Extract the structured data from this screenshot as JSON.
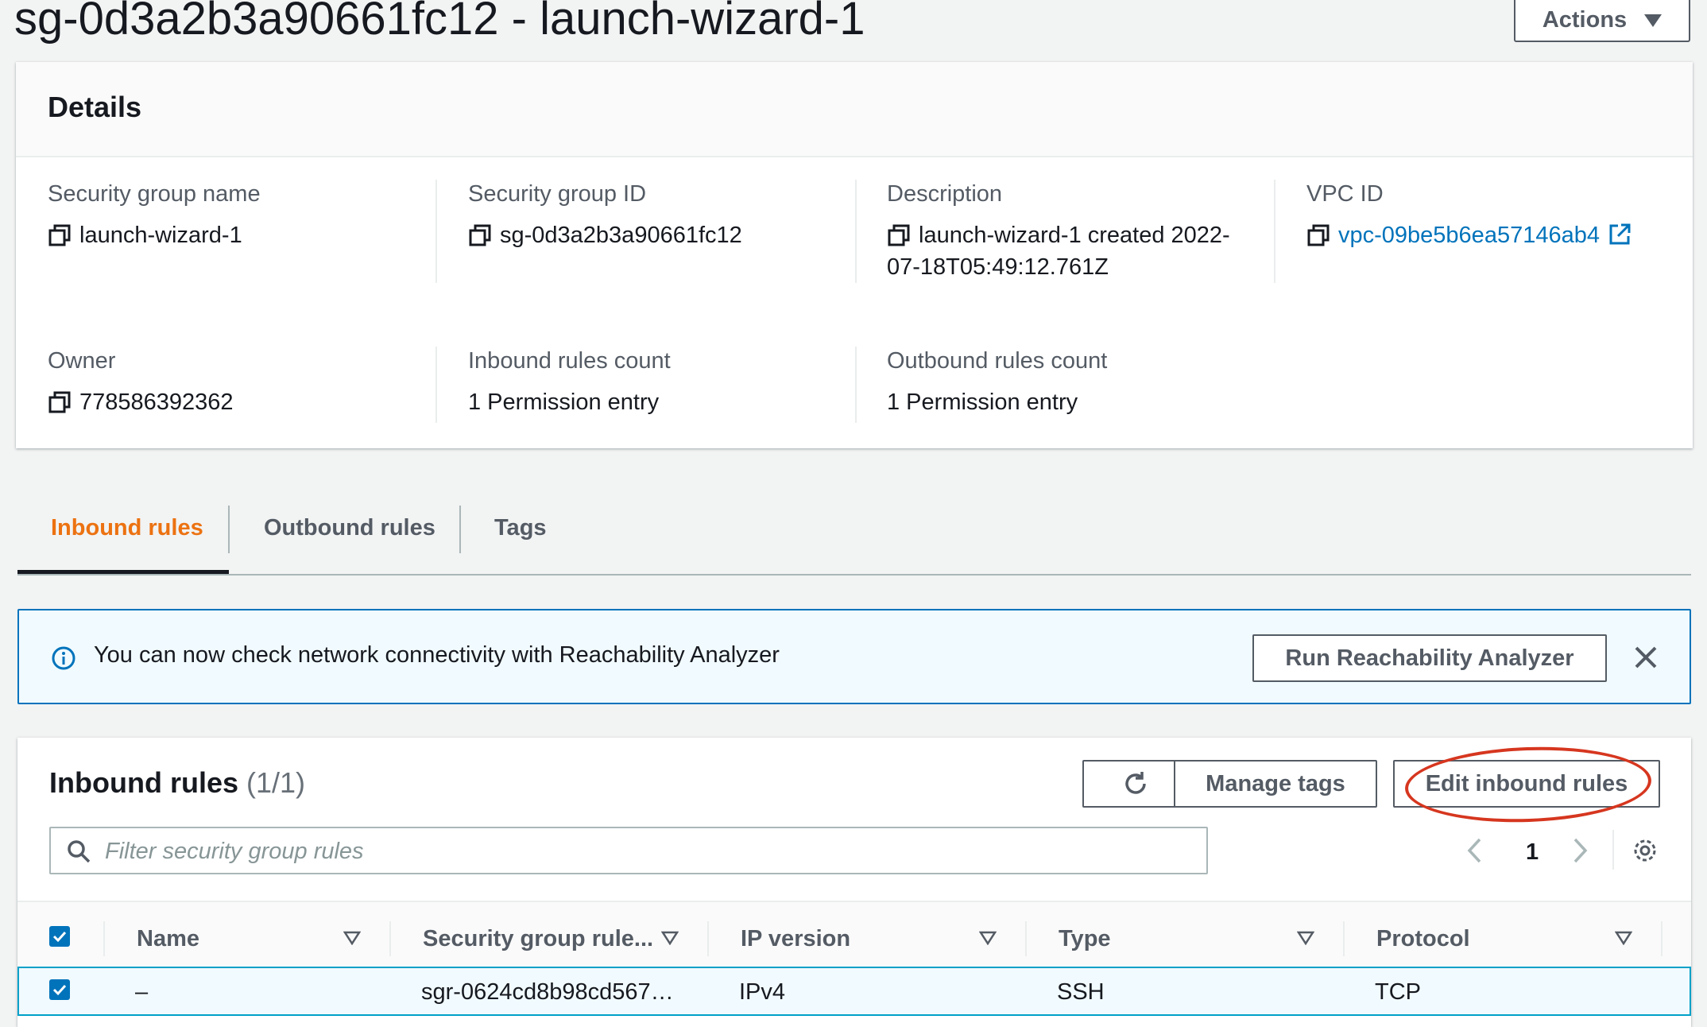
{
  "header": {
    "title": "sg-0d3a2b3a90661fc12 - launch-wizard-1",
    "actions_label": "Actions"
  },
  "details": {
    "title": "Details",
    "fields": [
      {
        "label": "Security group name",
        "value": "launch-wizard-1",
        "icon": "copy-icon"
      },
      {
        "label": "Security group ID",
        "value": "sg-0d3a2b3a90661fc12",
        "icon": "copy-icon"
      },
      {
        "label": "Description",
        "value_line1": "launch-wizard-1 created 2022-",
        "value_line2": "07-18T05:49:12.761Z",
        "icon": "copy-icon"
      },
      {
        "label": "VPC ID",
        "value": "vpc-09be5b6ea57146ab4",
        "icon": "copy-icon",
        "link_icon": "external-link-icon"
      },
      {
        "label": "Owner",
        "value": "778586392362",
        "icon": "copy-icon"
      },
      {
        "label": "Inbound rules count",
        "value": "1 Permission entry"
      },
      {
        "label": "Outbound rules count",
        "value": "1 Permission entry"
      }
    ]
  },
  "tabs": [
    {
      "label": "Inbound rules",
      "active": true
    },
    {
      "label": "Outbound rules",
      "active": false
    },
    {
      "label": "Tags",
      "active": false
    }
  ],
  "banner": {
    "icon": "info-icon",
    "text": "You can now check network connectivity with Reachability Analyzer",
    "button_label": "Run Reachability Analyzer",
    "close_icon": "close-icon"
  },
  "rules": {
    "title": "Inbound rules",
    "count": "(1/1)",
    "refresh_icon": "refresh-icon",
    "manage_tags_label": "Manage tags",
    "edit_label": "Edit inbound rules",
    "search_placeholder": "Filter security group rules",
    "page_number": "1",
    "columns": [
      "Name",
      "Security group rule...",
      "IP version",
      "Type",
      "Protocol"
    ],
    "rows": [
      {
        "name": "–",
        "rule_id": "sgr-0624cd8b98cd567…",
        "ip_version": "IPv4",
        "type": "SSH",
        "protocol": "TCP",
        "selected": true
      }
    ]
  },
  "colors": {
    "accent_orange": "#ec7211",
    "link_blue": "#0073bb",
    "annotation_red": "#d6361f"
  }
}
